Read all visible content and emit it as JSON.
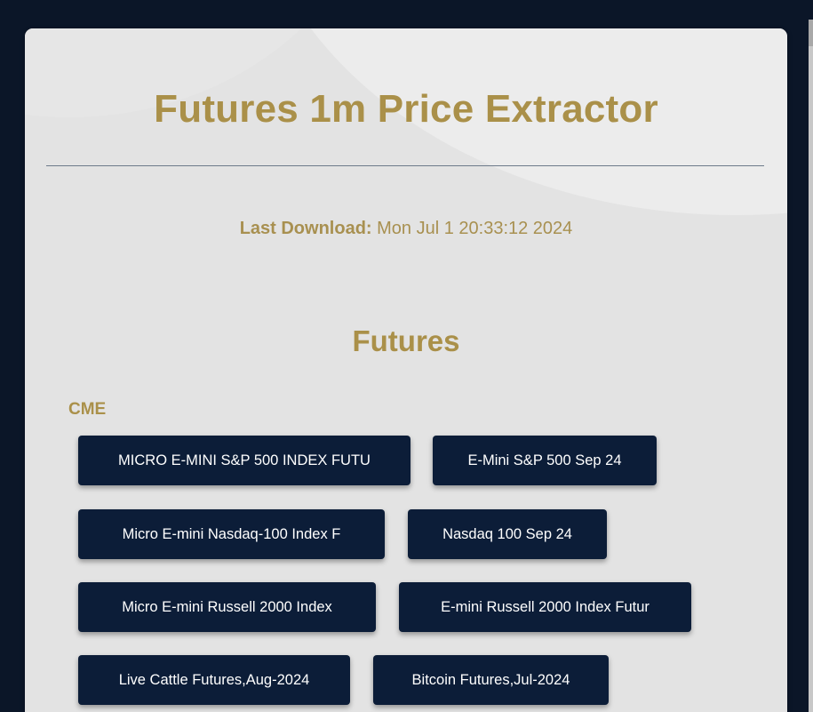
{
  "app": {
    "title": "Futures 1m Price Extractor"
  },
  "status": {
    "last_download_label": "Last Download:",
    "last_download_value": " Mon Jul 1 20:33:12 2024"
  },
  "futures": {
    "section_title": "Futures",
    "groups": [
      {
        "name": "CME",
        "buttons": [
          "MICRO E-MINI S&P 500 INDEX FUTU",
          "E-Mini S&P 500 Sep 24",
          "Micro E-mini Nasdaq-100 Index F",
          "Nasdaq 100 Sep 24",
          "Micro E-mini Russell 2000 Index",
          "E-mini Russell 2000 Index Futur",
          "Live Cattle Futures,Aug-2024",
          "Bitcoin Futures,Jul-2024"
        ]
      }
    ]
  },
  "colors": {
    "accent_gold": "#aa9049",
    "button_navy": "#0c1d38",
    "background_dark": "#0b1628",
    "card_bg": "#e3e3e3"
  }
}
